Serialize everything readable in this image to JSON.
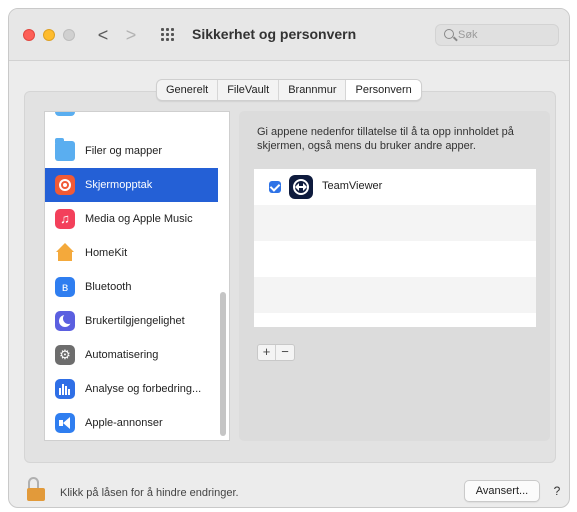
{
  "window": {
    "title": "Sikkerhet og personvern",
    "search_placeholder": "Søk"
  },
  "toolbar": {
    "back_glyph": "<",
    "forward_glyph": ">"
  },
  "tabs": [
    {
      "label": "Generelt",
      "active": false
    },
    {
      "label": "FileVault",
      "active": false
    },
    {
      "label": "Brannmur",
      "active": false
    },
    {
      "label": "Personvern",
      "active": true
    }
  ],
  "sidebar": {
    "items": [
      {
        "label": "Filer og mapper",
        "icon": "folder-icon",
        "color": "#5aaef0",
        "selected": false
      },
      {
        "label": "Skjermopptak",
        "icon": "screen-recording-icon",
        "color": "#f15a36",
        "selected": true
      },
      {
        "label": "Media og Apple Music",
        "icon": "music-icon",
        "color": "#f3405b",
        "selected": false
      },
      {
        "label": "HomeKit",
        "icon": "home-icon",
        "color": "#f4a93b",
        "selected": false
      },
      {
        "label": "Bluetooth",
        "icon": "bluetooth-icon",
        "color": "#2f7ef0",
        "selected": false
      },
      {
        "label": "Brukertilgjengelighet",
        "icon": "accessibility-icon",
        "color": "#5b5fe0",
        "selected": false
      },
      {
        "label": "Automatisering",
        "icon": "gear-icon",
        "color": "#6d6d6d",
        "selected": false
      },
      {
        "label": "Analyse og forbedring...",
        "icon": "analytics-icon",
        "color": "#2f6fe6",
        "selected": false
      },
      {
        "label": "Apple-annonser",
        "icon": "megaphone-icon",
        "color": "#2f7ef0",
        "selected": false
      }
    ]
  },
  "main": {
    "description": "Gi appene nedenfor tillatelse til å ta opp innholdet på skjermen, også mens du bruker andre apper.",
    "apps": [
      {
        "name": "TeamViewer",
        "checked": true
      }
    ],
    "add_label": "+",
    "remove_label": "−"
  },
  "footer": {
    "lock_text": "Klikk på låsen for å hindre endringer.",
    "advanced_label": "Avansert...",
    "help_label": "?"
  }
}
